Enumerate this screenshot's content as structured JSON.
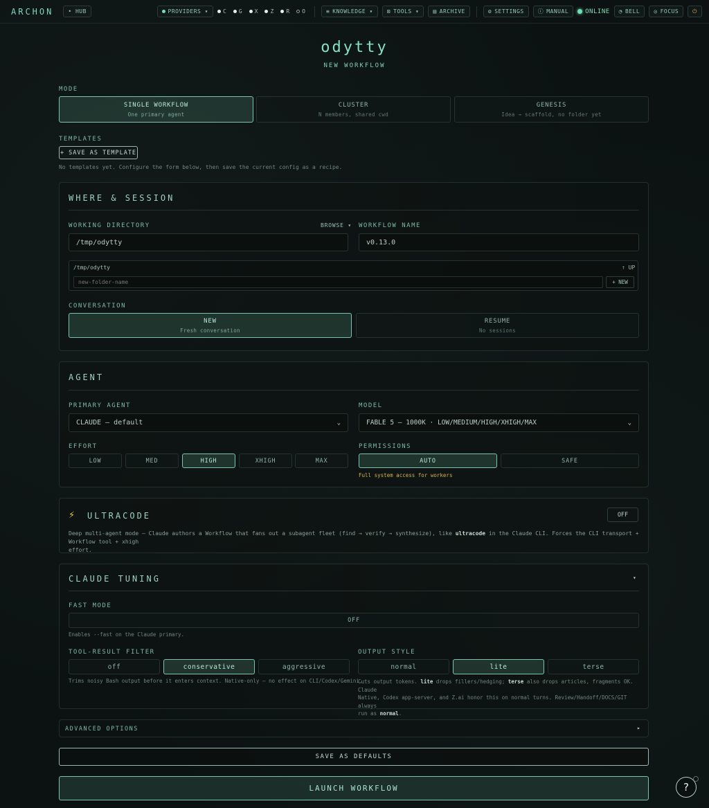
{
  "topbar": {
    "brand": "ARCHON",
    "hub": "• HUB",
    "providers": "PROVIDERS ▾",
    "provider_list": [
      {
        "letter": "C",
        "color": "#e8eeec"
      },
      {
        "letter": "G",
        "color": "#e8eeec"
      },
      {
        "letter": "X",
        "color": "#e8eeec"
      },
      {
        "letter": "Z",
        "color": "#e8eeec"
      },
      {
        "letter": "R",
        "color": "#e8eeec"
      },
      {
        "letter": "O",
        "color": "#5a6a66"
      }
    ],
    "knowledge": "KNOWLEDGE ▾",
    "tools": "TOOLS ▾",
    "archive": "ARCHIVE",
    "settings": "SETTINGS",
    "manual": "MANUAL",
    "online": "ONLINE",
    "bell": "BELL",
    "focus": "FOCUS",
    "power": "⏻"
  },
  "header": {
    "title": "odytty",
    "subtitle": "NEW WORKFLOW"
  },
  "mode": {
    "label": "MODE",
    "options": [
      {
        "label": "SINGLE WORKFLOW",
        "sub": "One primary agent"
      },
      {
        "label": "CLUSTER",
        "sub": "N members, shared cwd"
      },
      {
        "label": "GENESIS",
        "sub": "Idea → scaffold, no folder yet"
      }
    ]
  },
  "templates": {
    "label": "TEMPLATES",
    "save_button": "+ SAVE AS TEMPLATE",
    "hint": "No templates yet. Configure the form below, then save the current config as a recipe."
  },
  "where": {
    "title": "WHERE & SESSION",
    "working_dir_label": "WORKING DIRECTORY",
    "browse": "BROWSE ▾",
    "working_dir_value": "/tmp/odytty",
    "workflow_name_label": "WORKFLOW NAME",
    "workflow_name_value": "v0.13.0",
    "browser_path": "/tmp/odytty",
    "up": "⇡ UP",
    "new_folder_placeholder": "new-folder-name",
    "new_button": "+ NEW",
    "conversation_label": "CONVERSATION",
    "conversation": [
      {
        "label": "NEW",
        "sub": "Fresh conversation"
      },
      {
        "label": "RESUME",
        "sub": "No sessions"
      }
    ]
  },
  "agent": {
    "title": "AGENT",
    "primary_label": "PRIMARY AGENT",
    "primary_value": "CLAUDE — default",
    "model_label": "MODEL",
    "model_value": "FABLE 5 — 1000K · LOW/MEDIUM/HIGH/XHIGH/MAX",
    "effort_label": "EFFORT",
    "effort": [
      "LOW",
      "MED",
      "HIGH",
      "XHIGH",
      "MAX"
    ],
    "permissions_label": "PERMISSIONS",
    "permissions": [
      "AUTO",
      "SAFE"
    ],
    "permissions_hint": "Full system access for workers"
  },
  "ultracode": {
    "icon": "⚡",
    "title": "ULTRACODE",
    "toggle": "OFF",
    "desc_1": "Deep multi-agent mode — Claude authors a Workflow that fans out a subagent fleet (find → verify → synthesize), like ",
    "desc_bold": "ultracode",
    "desc_2": " in the Claude CLI. Forces the CLI transport + Workflow tool + xhigh",
    "desc_3": "effort."
  },
  "tuning": {
    "title": "CLAUDE TUNING",
    "caret": "▾",
    "fast_label": "FAST MODE",
    "fast_value": "OFF",
    "fast_hint": "Enables --fast on the Claude primary.",
    "filter_label": "TOOL-RESULT FILTER",
    "filter": [
      "off",
      "conservative",
      "aggressive"
    ],
    "filter_hint": "Trims noisy Bash output before it enters context. Native-only — no effect on CLI/Codex/Gemini.",
    "style_label": "OUTPUT STYLE",
    "style": [
      "normal",
      "lite",
      "terse"
    ],
    "style_hint_a": "Cuts output tokens. ",
    "style_hint_lite": "lite",
    "style_hint_b": " drops fillers/hedging; ",
    "style_hint_terse": "terse",
    "style_hint_c": " also drops articles, fragments OK. Claude",
    "style_hint_d": "Native, Codex app-server, and Z.ai honor this on normal turns. Review/Handoff/DOCS/GIT always",
    "style_hint_e": "run as ",
    "style_hint_normal": "normal",
    "style_hint_f": "."
  },
  "advanced": {
    "label": "ADVANCED OPTIONS",
    "caret": "▸"
  },
  "actions": {
    "save_defaults": "SAVE AS DEFAULTS",
    "launch": "LAUNCH WORKFLOW"
  },
  "help": "?"
}
